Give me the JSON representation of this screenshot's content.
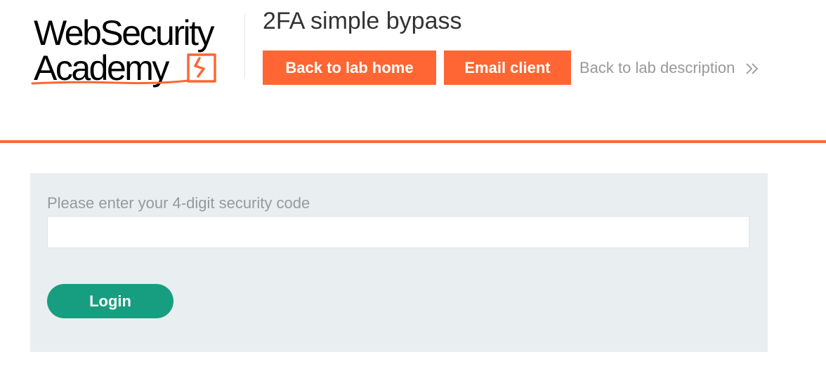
{
  "logo": {
    "line1": "WebSecurity",
    "line2": "Academy",
    "accent_color": "#ff6633"
  },
  "header": {
    "title": "2FA simple bypass",
    "buttons": {
      "back_to_lab_home": "Back to lab home",
      "email_client": "Email client"
    },
    "back_to_description": "Back to lab description",
    "back_icon": "double-chevron-right-icon"
  },
  "form": {
    "label": "Please enter your 4-digit security code",
    "code_value": "",
    "submit_label": "Login"
  },
  "colors": {
    "orange": "#ff6633",
    "green": "#179e80",
    "panel": "#e9eef1",
    "muted_text": "#999999"
  }
}
